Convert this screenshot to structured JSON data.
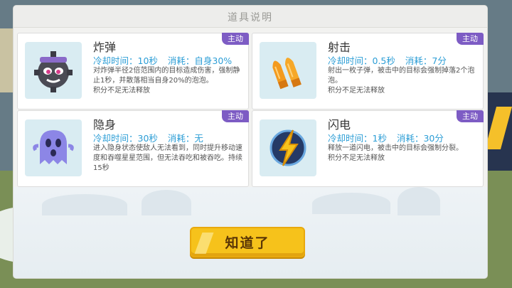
{
  "dialog": {
    "title": "道具说明",
    "confirm_label": "知道了"
  },
  "items": [
    {
      "name": "炸弹",
      "tag": "主动",
      "cooldown": "冷却时间：10秒",
      "cost": "消耗：自身30%",
      "desc": "对炸弹半径2倍范围内的目标造成伤害，强制静止1秒，并散落相当自身20%的泡泡。",
      "note": "积分不足无法释放",
      "icon": "bomb-icon"
    },
    {
      "name": "射击",
      "tag": "主动",
      "cooldown": "冷却时间：0.5秒",
      "cost": "消耗：7分",
      "desc": "射出一枚子弹，被击中的目标会强制掉落2个泡泡。",
      "note": "积分不足无法释放",
      "icon": "bullets-icon"
    },
    {
      "name": "隐身",
      "tag": "主动",
      "cooldown": "冷却时间：30秒",
      "cost": "消耗：无",
      "desc": "进入隐身状态使敌人无法看到，同时提升移动速度和吞噬星星范围，但无法吞吃和被吞吃。持续15秒",
      "note": "",
      "icon": "ghost-icon"
    },
    {
      "name": "闪电",
      "tag": "主动",
      "cooldown": "冷却时间：1秒",
      "cost": "消耗：30分",
      "desc": "释放一道闪电，被击中的目标会强制分裂。",
      "note": "积分不足无法释放",
      "icon": "lightning-icon"
    }
  ]
}
